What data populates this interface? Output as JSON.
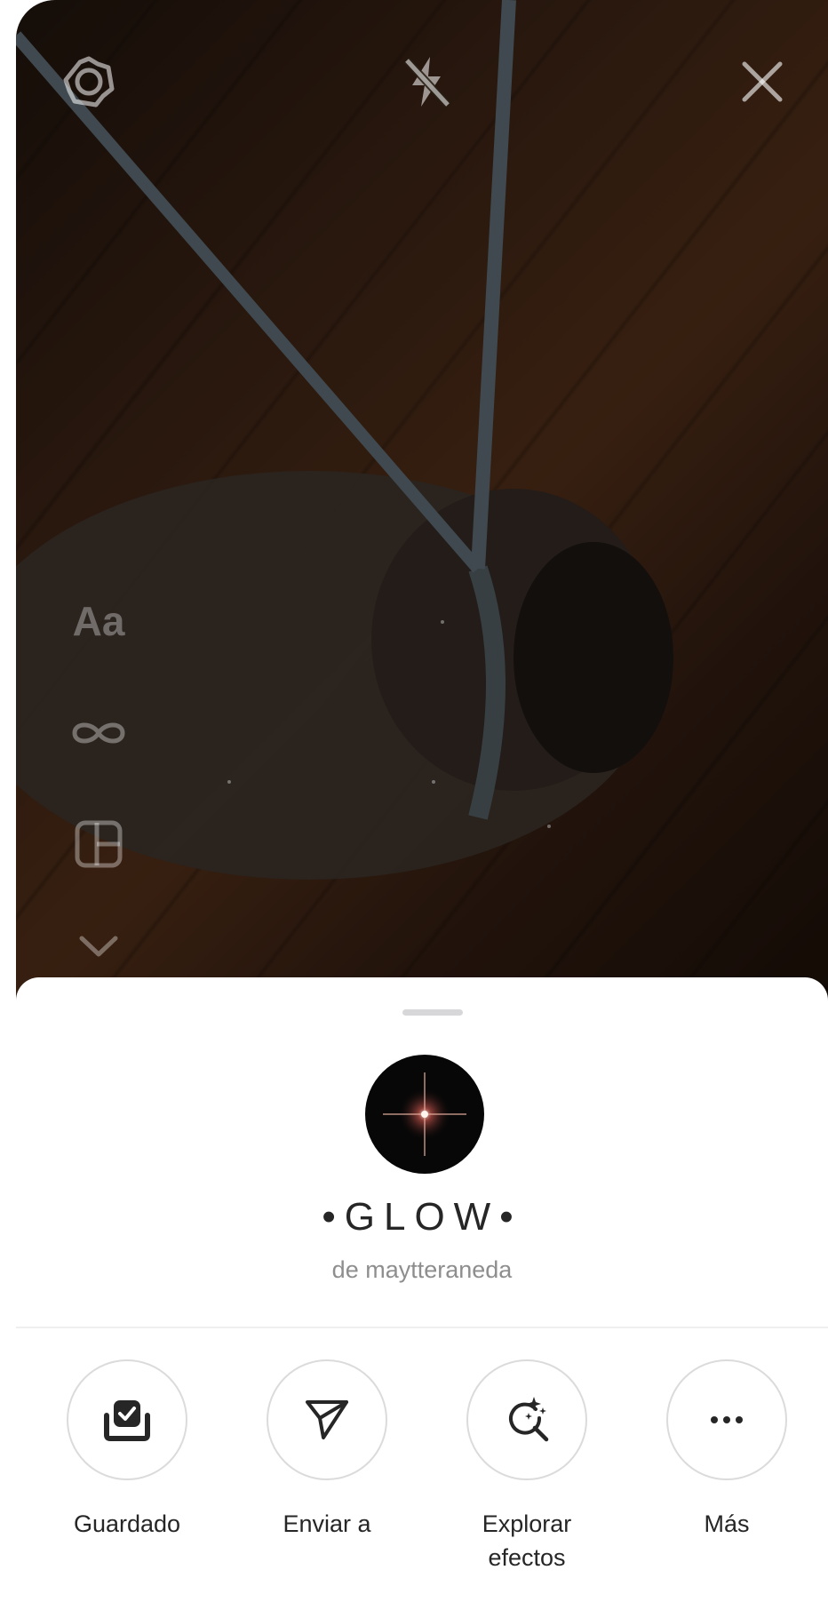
{
  "camera": {
    "icons": {
      "settings": "gear-icon",
      "flash": "flash-off-icon",
      "close": "close-icon"
    },
    "tools": [
      {
        "name": "text",
        "label": "Aa"
      },
      {
        "name": "boomerang",
        "icon": "infinity-icon"
      },
      {
        "name": "layout",
        "icon": "layout-grid-icon"
      },
      {
        "name": "more",
        "icon": "chevron-down-icon"
      }
    ]
  },
  "effect": {
    "title": "•GLOW•",
    "author": "de maytteraneda"
  },
  "actions": [
    {
      "label": "Guardado",
      "icon": "saved-check-icon"
    },
    {
      "label": "Enviar a",
      "icon": "send-icon"
    },
    {
      "label": "Explorar efectos",
      "icon": "explore-effects-icon"
    },
    {
      "label": "Más",
      "icon": "more-dots-icon"
    }
  ],
  "colors": {
    "sheet_background": "#ffffff",
    "text_primary": "#262626",
    "text_secondary": "#8e8e8e",
    "divider": "#efefef"
  }
}
